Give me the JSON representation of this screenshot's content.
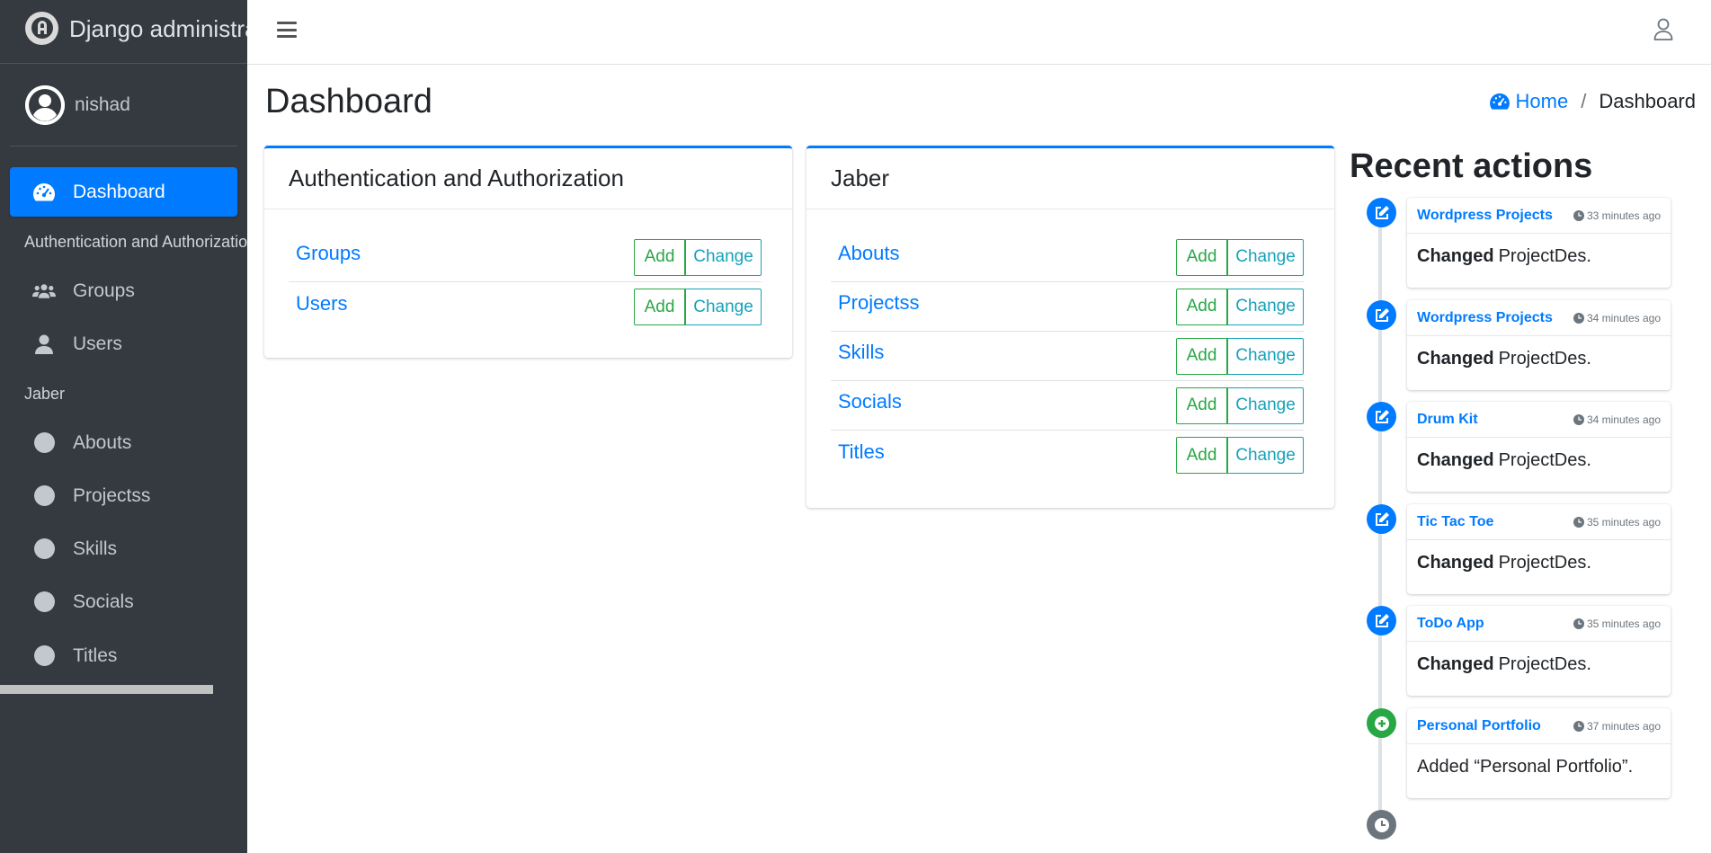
{
  "brand": {
    "title": "Django administration"
  },
  "user": {
    "name": "nishad"
  },
  "sidebar": {
    "dashboard": "Dashboard",
    "sections": [
      {
        "header": "Authentication and Authorization",
        "items": [
          "Groups",
          "Users"
        ]
      },
      {
        "header": "Jaber",
        "items": [
          "Abouts",
          "Projectss",
          "Skills",
          "Socials",
          "Titles"
        ]
      }
    ]
  },
  "page": {
    "title": "Dashboard"
  },
  "breadcrumb": {
    "home": "Home",
    "separator": "/",
    "current": "Dashboard"
  },
  "apps": [
    {
      "title": "Authentication and Authorization",
      "models": [
        "Groups",
        "Users"
      ]
    },
    {
      "title": "Jaber",
      "models": [
        "Abouts",
        "Projectss",
        "Skills",
        "Socials",
        "Titles"
      ]
    }
  ],
  "buttons": {
    "add": "Add",
    "change": "Change"
  },
  "recent": {
    "title": "Recent actions",
    "items": [
      {
        "object": "Wordpress Projects",
        "time": "33 minutes ago",
        "verb": "Changed",
        "detail": "ProjectDes.",
        "kind": "change"
      },
      {
        "object": "Wordpress Projects",
        "time": "34 minutes ago",
        "verb": "Changed",
        "detail": "ProjectDes.",
        "kind": "change"
      },
      {
        "object": "Drum Kit",
        "time": "34 minutes ago",
        "verb": "Changed",
        "detail": "ProjectDes.",
        "kind": "change"
      },
      {
        "object": "Tic Tac Toe",
        "time": "35 minutes ago",
        "verb": "Changed",
        "detail": "ProjectDes.",
        "kind": "change"
      },
      {
        "object": "ToDo App",
        "time": "35 minutes ago",
        "verb": "Changed",
        "detail": "ProjectDes.",
        "kind": "change"
      },
      {
        "object": "Personal Portfolio",
        "time": "37 minutes ago",
        "verb": "",
        "detail": "Added “Personal Portfolio”.",
        "kind": "add"
      }
    ]
  },
  "colors": {
    "primary": "#007bff",
    "success": "#28a745",
    "info": "#17a2b8",
    "sidebar": "#343a40"
  }
}
